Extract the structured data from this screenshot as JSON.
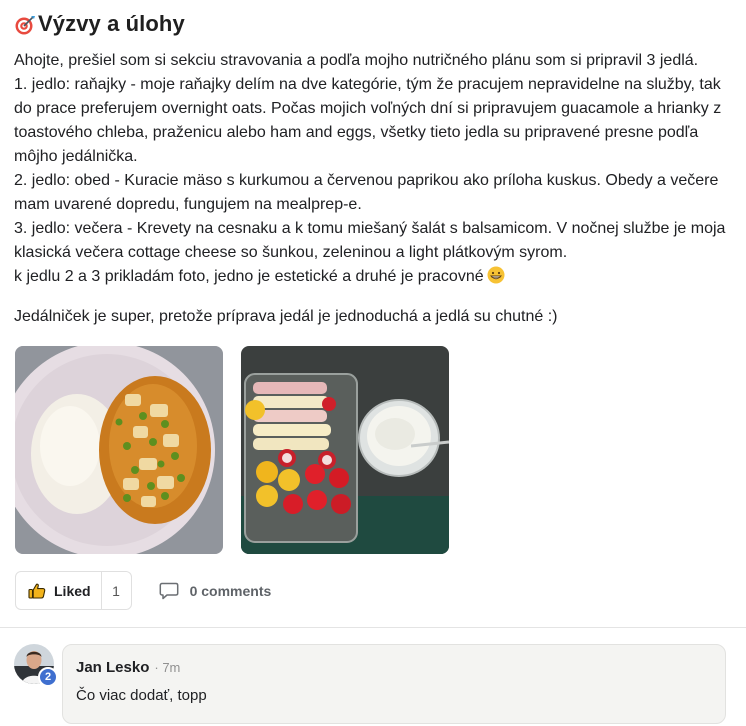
{
  "post": {
    "title": "Výzvy a úlohy",
    "title_icon": "target-dart-icon",
    "body_lines": [
      "Ahojte, prešiel som si sekciu stravovania a podľa mojho nutričného plánu som si pripravil 3 jedlá.",
      "1. jedlo: raňajky - moje raňajky delím na dve kategórie, tým že pracujem nepravidelne na služby, tak",
      "do prace preferujem overnight oats. Počas mojich voľných dní si pripravujem guacamole a hrianky z",
      "toastového chleba, praženicu alebo ham and eggs, všetky tieto jedla su pripravené presne podľa",
      "môjho jedálnička.",
      "2. jedlo: obed - Kuracie mäso s kurkumou a červenou paprikou ako príloha kuskus. Obedy a večere",
      "mam uvarené dopredu, fungujem na mealprep-e.",
      "3. jedlo: večera - Krevety na cesnaku a k tomu miešaný šalát s balsamicom. V nočnej službe je moja",
      "klasická večera cottage cheese so šunkou, zeleninou a light plátkovým syrom.",
      "k jedlu 2 a 3 prikladám foto, jedno je estetické a druhé je pracovné"
    ],
    "emoji": "grinning-face-emoji",
    "summary": "Jedálniček je super, pretože príprava jedál je jednoduchá a jedlá su chutné :)",
    "photos": [
      {
        "subject": "chicken-couscous-peas-plate"
      },
      {
        "subject": "mealprep-container-ham-cheese-vegetables-cottage-cheese"
      }
    ]
  },
  "actions": {
    "like_label": "Liked",
    "like_count": "1",
    "like_icon": "thumbs-up-icon",
    "comments_label": "0 comments",
    "comments_icon": "comment-bubble-icon"
  },
  "comment": {
    "author": "Jan Lesko",
    "time": "· 7m",
    "text": "Čo viac dodať, topp",
    "level": "2"
  },
  "colors": {
    "accent": "#3f6fcf",
    "text": "#202124",
    "muted": "#909090",
    "bubble_bg": "#f4f4f2",
    "like_icon": "#f2b31b"
  }
}
